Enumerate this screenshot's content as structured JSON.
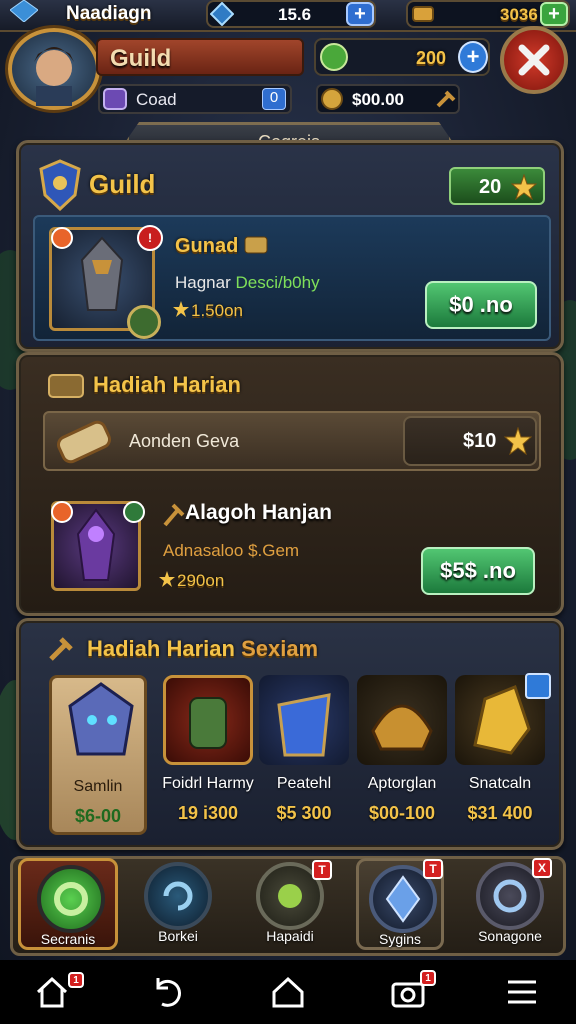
{
  "top_bar": {
    "title": "Naadiagn",
    "gem_value": "15.6",
    "gold_value": "3036"
  },
  "header": {
    "guild_label": "Guild",
    "gem_value": "200",
    "sub_label": "Coad",
    "sub_count": "0",
    "gold_value": "$00.00"
  },
  "tab_title": "Coqreis",
  "guild_card": {
    "title": "Guild",
    "rating": "20",
    "hero_name": "Gunad",
    "subtitle_prefix": "Hagnar",
    "subtitle_highlight": "Desci/b0hy",
    "stars": "1.50on",
    "button": "$0 .no"
  },
  "daily": {
    "title": "Hadiah Harian",
    "row_label": "Aonden Geva",
    "row_price": "$10",
    "hero_name": "Alagoh Hanjan",
    "hero_desc": "Adnasaloo $.Gem",
    "hero_stars": "290on",
    "button": "$5$ .no"
  },
  "special": {
    "title": "Hadiah Harian",
    "title_suffix": "Sexiam",
    "items": [
      {
        "name": "Samlin",
        "price": "$6-00"
      },
      {
        "name": "Foidrl Harmy",
        "price": "19 i300"
      },
      {
        "name": "Peatehl",
        "price": "$5 300"
      },
      {
        "name": "Aptorglan",
        "price": "$00-100"
      },
      {
        "name": "Snatcaln",
        "price": "$31 400"
      }
    ]
  },
  "bottom_tabs": [
    {
      "label": "Secranis"
    },
    {
      "label": "Borkei"
    },
    {
      "label": "Hapaidi"
    },
    {
      "label": "Sygins"
    },
    {
      "label": "Sonagone"
    }
  ],
  "badges": {
    "tab3": "T",
    "tab4": "T",
    "tab5": "X",
    "nav_home": "1",
    "nav_camera": "1"
  },
  "colors": {
    "gold": "#f3c349",
    "green_button": "#2e9c52",
    "badge_red": "#d32020",
    "panel_border": "#6f5f45"
  }
}
